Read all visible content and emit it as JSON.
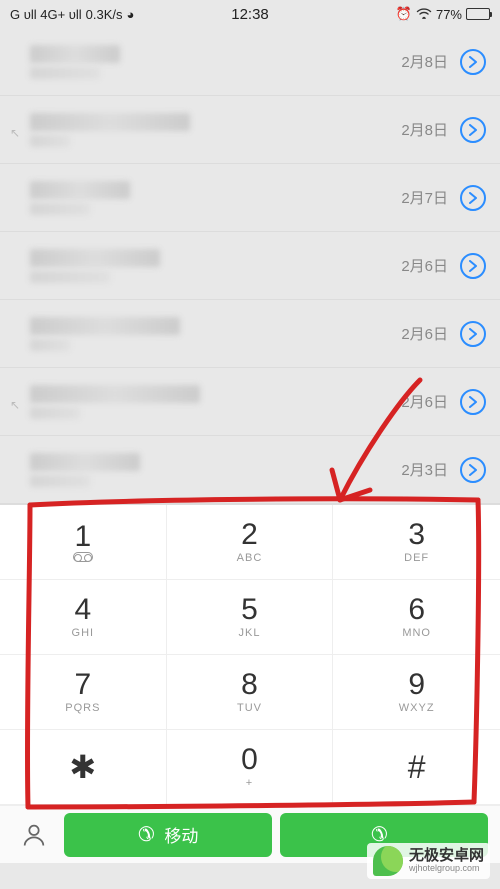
{
  "status": {
    "network": "G ᴜll 4G+ ᴜll",
    "speed": "0.3K/s",
    "time": "12:38",
    "battery_pct": "77%"
  },
  "call_log": [
    {
      "date": "2月8日",
      "has_outgoing_icon": false,
      "w1": 90,
      "w2": 70
    },
    {
      "date": "2月8日",
      "has_outgoing_icon": true,
      "w1": 160,
      "w2": 40
    },
    {
      "date": "2月7日",
      "has_outgoing_icon": false,
      "w1": 100,
      "w2": 60
    },
    {
      "date": "2月6日",
      "has_outgoing_icon": false,
      "w1": 130,
      "w2": 80
    },
    {
      "date": "2月6日",
      "has_outgoing_icon": false,
      "w1": 150,
      "w2": 40
    },
    {
      "date": "2月6日",
      "has_outgoing_icon": true,
      "w1": 170,
      "w2": 50
    },
    {
      "date": "2月3日",
      "has_outgoing_icon": false,
      "w1": 110,
      "w2": 60
    }
  ],
  "dial_keys": [
    {
      "digit": "1",
      "sub": "voicemail"
    },
    {
      "digit": "2",
      "sub": "ABC"
    },
    {
      "digit": "3",
      "sub": "DEF"
    },
    {
      "digit": "4",
      "sub": "GHI"
    },
    {
      "digit": "5",
      "sub": "JKL"
    },
    {
      "digit": "6",
      "sub": "MNO"
    },
    {
      "digit": "7",
      "sub": "PQRS"
    },
    {
      "digit": "8",
      "sub": "TUV"
    },
    {
      "digit": "9",
      "sub": "WXYZ"
    },
    {
      "digit": "✱",
      "sub": ""
    },
    {
      "digit": "0",
      "sub": "+"
    },
    {
      "digit": "#",
      "sub": ""
    }
  ],
  "bottom": {
    "call_button_1": "移动",
    "call_button_2": ""
  },
  "watermark": {
    "title": "无极安卓网",
    "url": "wjhotelgroup.com"
  }
}
